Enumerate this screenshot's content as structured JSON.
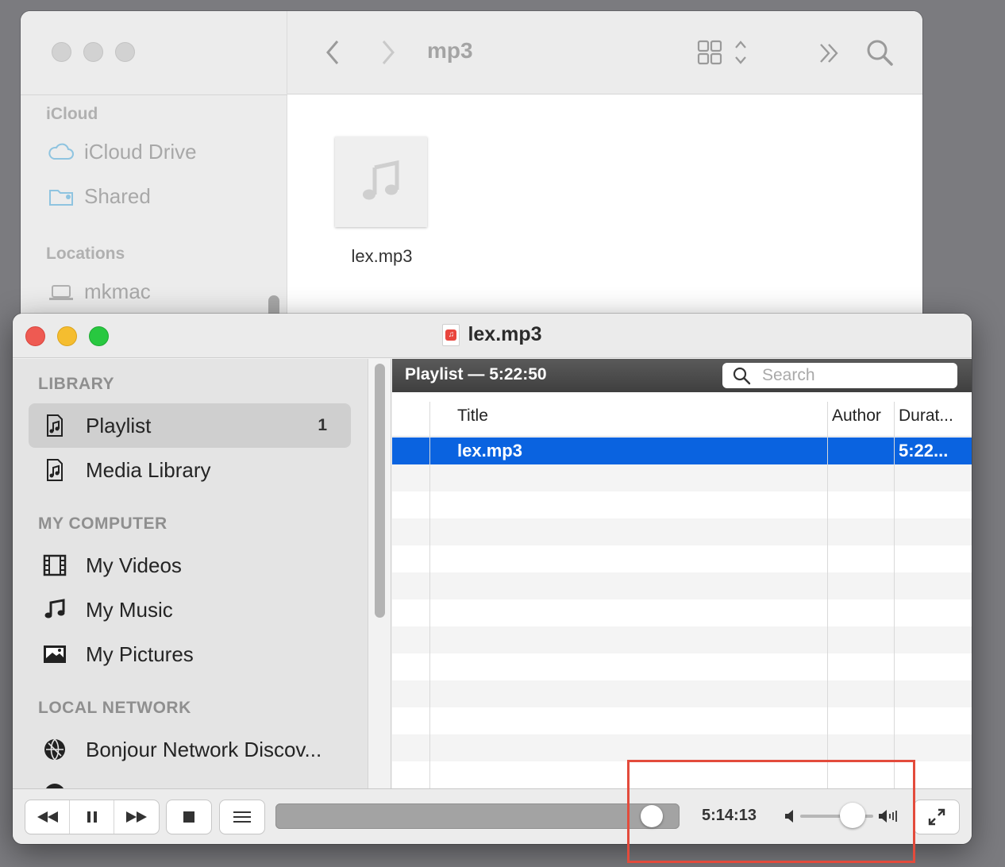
{
  "finder": {
    "title": "mp3",
    "sidebar": {
      "section_icloud": "iCloud",
      "icloud_drive": "iCloud Drive",
      "shared": "Shared",
      "section_locations": "Locations",
      "mkmac": "mkmac"
    },
    "file": {
      "name": "lex.mp3",
      "icon": "music-note-icon"
    }
  },
  "vlc": {
    "window_title": "lex.mp3",
    "library": {
      "section_library": "LIBRARY",
      "playlist": "Playlist",
      "playlist_count": "1",
      "media_library": "Media Library",
      "section_my_computer": "MY COMPUTER",
      "my_videos": "My Videos",
      "my_music": "My Music",
      "my_pictures": "My Pictures",
      "section_local_network": "LOCAL NETWORK",
      "bonjour": "Bonjour Network Discov..."
    },
    "playlist": {
      "header": "Playlist — 5:22:50",
      "search_placeholder": "Search",
      "columns": {
        "title": "Title",
        "author": "Author",
        "duration": "Durat..."
      },
      "rows": [
        {
          "title": "lex.mp3",
          "author": "",
          "duration": "5:22..."
        }
      ]
    },
    "controls": {
      "elapsed": "5:14:13",
      "progress_fraction": 0.96,
      "volume_fraction": 0.72
    }
  },
  "colors": {
    "selection": "#0a63e0",
    "highlight_box": "#e34b3c",
    "close": "#ee5a52",
    "minimize": "#f5bd2f",
    "zoom": "#28c840"
  }
}
